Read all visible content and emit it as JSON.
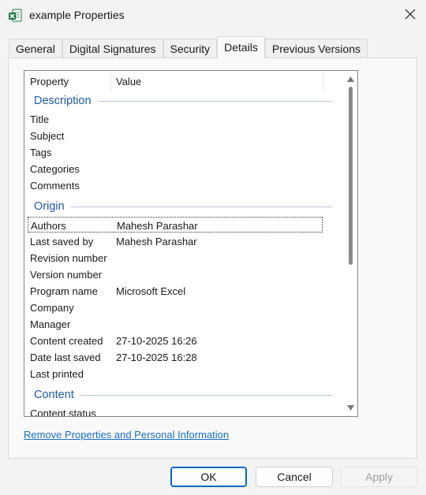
{
  "window": {
    "title": "example Properties"
  },
  "tabs": [
    {
      "label": "General",
      "active": false
    },
    {
      "label": "Digital Signatures",
      "active": false
    },
    {
      "label": "Security",
      "active": false
    },
    {
      "label": "Details",
      "active": true
    },
    {
      "label": "Previous Versions",
      "active": false
    }
  ],
  "list": {
    "columns": {
      "property": "Property",
      "value": "Value"
    },
    "groups": {
      "description": "Description",
      "origin": "Origin",
      "content": "Content"
    },
    "description_rows": [
      {
        "property": "Title",
        "value": ""
      },
      {
        "property": "Subject",
        "value": ""
      },
      {
        "property": "Tags",
        "value": ""
      },
      {
        "property": "Categories",
        "value": ""
      },
      {
        "property": "Comments",
        "value": ""
      }
    ],
    "origin_rows": [
      {
        "property": "Authors",
        "value": "Mahesh Parashar"
      },
      {
        "property": "Last saved by",
        "value": "Mahesh Parashar"
      },
      {
        "property": "Revision number",
        "value": ""
      },
      {
        "property": "Version number",
        "value": ""
      },
      {
        "property": "Program name",
        "value": "Microsoft Excel"
      },
      {
        "property": "Company",
        "value": ""
      },
      {
        "property": "Manager",
        "value": ""
      },
      {
        "property": "Content created",
        "value": "27-10-2025 16:26"
      },
      {
        "property": "Date last saved",
        "value": "27-10-2025 16:28"
      },
      {
        "property": "Last printed",
        "value": ""
      }
    ],
    "content_rows": [
      {
        "property": "Content status",
        "value": ""
      }
    ]
  },
  "remove_link": "Remove Properties and Personal Information",
  "buttons": {
    "ok": "OK",
    "cancel": "Cancel",
    "apply": "Apply"
  },
  "colors": {
    "accent": "#0067c0",
    "group_label": "#1e5aa8",
    "link": "#1a6fc4",
    "excel_green": "#1d6f42"
  },
  "icons": {
    "app": "excel-file-icon",
    "close": "close-icon",
    "scroll_up": "scroll-up-icon",
    "scroll_down": "scroll-down-icon"
  }
}
